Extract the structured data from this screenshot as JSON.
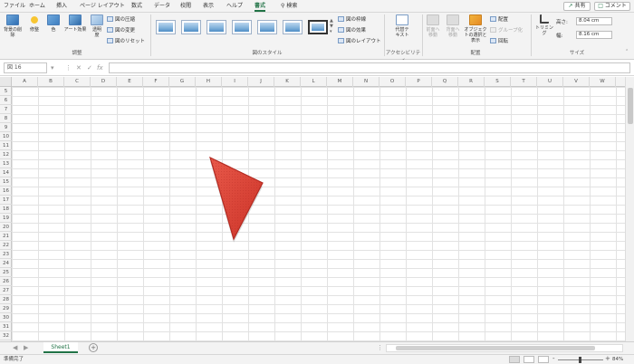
{
  "tabs": [
    {
      "label": "ファイル"
    },
    {
      "label": "ホーム"
    },
    {
      "label": "挿入"
    },
    {
      "label": "ページ レイアウト"
    },
    {
      "label": "数式"
    },
    {
      "label": "データ"
    },
    {
      "label": "校閲"
    },
    {
      "label": "表示"
    },
    {
      "label": "ヘルプ"
    },
    {
      "label": "書式"
    },
    {
      "label": "検索"
    }
  ],
  "share_label": "共有",
  "comment_label": "コメント",
  "ribbon": {
    "remove_bg": "背景の削除",
    "corrections": "修整",
    "color": "色",
    "artistic": "アート効果",
    "transparency": "透明度",
    "compress": "図の圧縮",
    "change": "図の変更",
    "reset": "図のリセット",
    "adjust_label": "調整",
    "styles_label": "図のスタイル",
    "border": "図の枠線",
    "effects": "図の効果",
    "layout": "図のレイアウト",
    "alt_text": "代替テキスト",
    "accessibility_label": "アクセシビリティ",
    "bring_forward": "前面へ移動",
    "send_backward": "背面へ移動",
    "selection_pane": "オブジェクトの選択と表示",
    "align": "配置",
    "group": "グループ化",
    "rotate": "回転",
    "arrange_label": "配置",
    "crop": "トリミング",
    "height_label": "高さ:",
    "height_value": "8.04 cm",
    "width_label": "幅:",
    "width_value": "8.16 cm",
    "size_label": "サイズ"
  },
  "formula": {
    "namebox": "図 16",
    "value": ""
  },
  "columns": [
    "A",
    "B",
    "C",
    "D",
    "E",
    "F",
    "G",
    "H",
    "I",
    "J",
    "K",
    "L",
    "M",
    "N",
    "O",
    "P",
    "Q",
    "R",
    "S",
    "T",
    "U",
    "V",
    "W"
  ],
  "rows": [
    "5",
    "6",
    "7",
    "8",
    "9",
    "10",
    "11",
    "12",
    "13",
    "14",
    "15",
    "16",
    "17",
    "18",
    "19",
    "20",
    "21",
    "22",
    "23",
    "24",
    "25",
    "26",
    "27",
    "28",
    "29",
    "30",
    "31",
    "32"
  ],
  "sheet_name": "Sheet1",
  "status_text": "準備完了",
  "zoom_text": "84%",
  "colors": {
    "accent": "#217346",
    "triangle": "#e0443a"
  }
}
